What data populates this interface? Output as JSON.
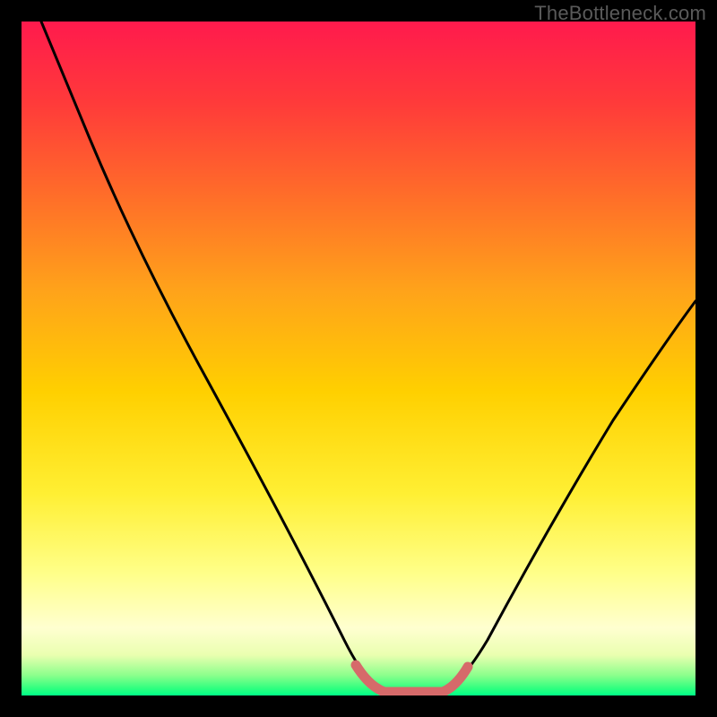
{
  "watermark": "TheBottleneck.com",
  "chart_data": {
    "type": "line",
    "title": "",
    "xlabel": "",
    "ylabel": "",
    "xlim": [
      0,
      100
    ],
    "ylim": [
      0,
      100
    ],
    "series": [
      {
        "name": "bottleneck-curve",
        "x": [
          3,
          10,
          20,
          30,
          40,
          48,
          52,
          55,
          60,
          63,
          70,
          80,
          90,
          100
        ],
        "y": [
          100,
          83,
          62,
          43,
          25,
          8,
          2,
          0,
          0,
          2,
          14,
          32,
          46,
          58
        ]
      }
    ],
    "highlight_band": {
      "name": "optimal-region",
      "x_from": 50,
      "x_to": 63
    },
    "colors": {
      "curve": "#000000",
      "highlight": "#d66a6a",
      "gradient_top": "#ff1a4d",
      "gradient_bottom": "#00ff88",
      "frame": "#000000",
      "watermark": "#5a5a5a"
    }
  }
}
